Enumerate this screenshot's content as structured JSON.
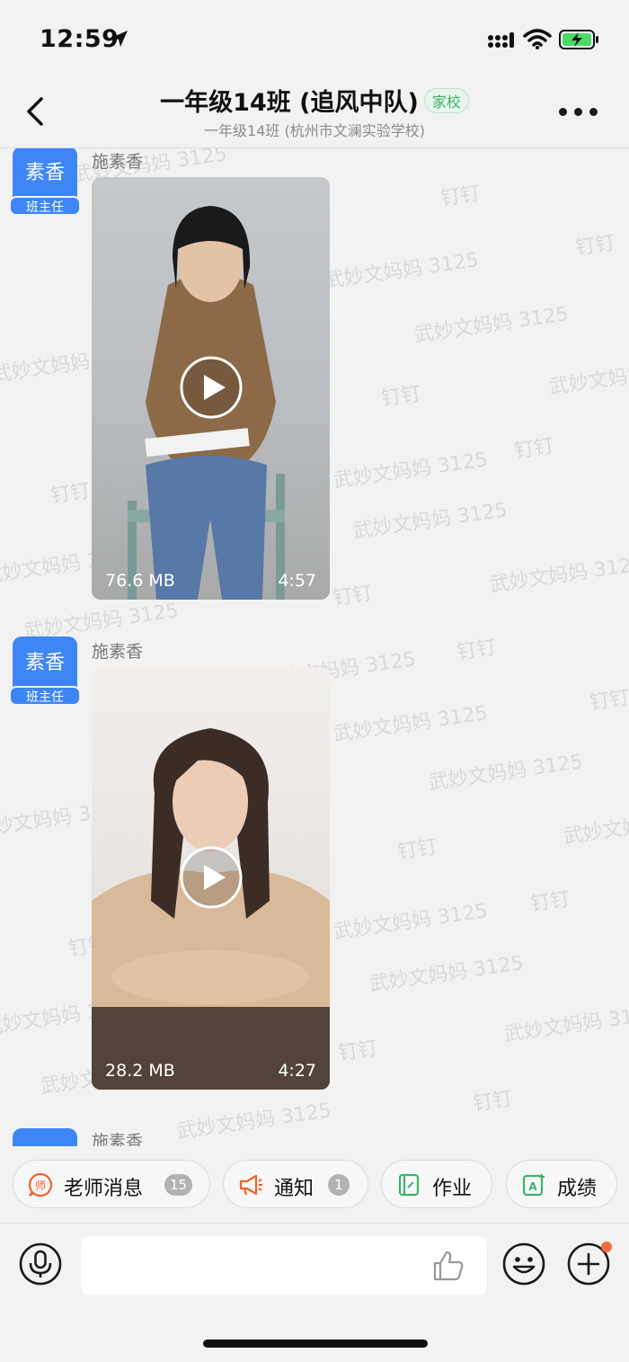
{
  "status_bar": {
    "time": "12:59"
  },
  "header": {
    "title": "一年级14班 (追风中队)",
    "tag": "家校",
    "subtitle": "一年级14班 (杭州市文澜实验学校)"
  },
  "watermarks": [
    "钉钉",
    "武妙文妈妈 3125"
  ],
  "messages": [
    {
      "avatar_text": "素香",
      "role": "班主任",
      "sender": "施素香",
      "video": {
        "size": "76.6 MB",
        "duration": "4:57"
      }
    },
    {
      "avatar_text": "素香",
      "role": "班主任",
      "sender": "施素香",
      "video": {
        "size": "28.2 MB",
        "duration": "4:27"
      }
    },
    {
      "sender": "施素香"
    }
  ],
  "quick_actions": [
    {
      "label": "老师消息",
      "badge": "15",
      "icon": "teacher-message-icon",
      "color": "#f0622d"
    },
    {
      "label": "通知",
      "badge": "1",
      "icon": "megaphone-icon",
      "color": "#f0622d"
    },
    {
      "label": "作业",
      "icon": "homework-book-icon",
      "color": "#3cb371"
    },
    {
      "label": "成绩",
      "icon": "grade-icon",
      "color": "#3cb371"
    }
  ],
  "input": {
    "placeholder": ""
  },
  "colors": {
    "accent_blue": "#3e86f5",
    "tag_green": "#3cb371",
    "badge_orange": "#f36a3c"
  }
}
